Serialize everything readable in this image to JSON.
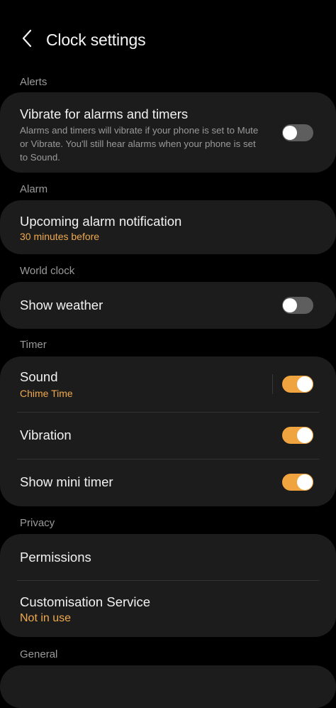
{
  "header": {
    "title": "Clock settings",
    "back_icon": "chevron-left-icon"
  },
  "colors": {
    "background": "#000000",
    "card": "#1c1c1c",
    "accent": "#f0a43f",
    "accent_text": "#f0a94e",
    "toggle_off": "#5e5e5e",
    "section_label": "#9a9a9a"
  },
  "sections": {
    "alerts": {
      "label": "Alerts",
      "vibrate": {
        "title": "Vibrate for alarms and timers",
        "description": "Alarms and timers will vibrate if your phone is set to Mute or Vibrate. You'll still hear alarms when your phone is set to Sound.",
        "enabled": false
      }
    },
    "alarm": {
      "label": "Alarm",
      "upcoming": {
        "title": "Upcoming alarm notification",
        "value": "30 minutes before"
      }
    },
    "world_clock": {
      "label": "World clock",
      "weather": {
        "title": "Show weather",
        "enabled": false
      }
    },
    "timer": {
      "label": "Timer",
      "sound": {
        "title": "Sound",
        "value": "Chime Time",
        "enabled": true
      },
      "vibration": {
        "title": "Vibration",
        "enabled": true
      },
      "mini_timer": {
        "title": "Show mini timer",
        "enabled": true
      }
    },
    "privacy": {
      "label": "Privacy",
      "permissions": {
        "title": "Permissions"
      },
      "customisation": {
        "title": "Customisation Service",
        "value": "Not in use"
      }
    },
    "general": {
      "label": "General"
    }
  }
}
